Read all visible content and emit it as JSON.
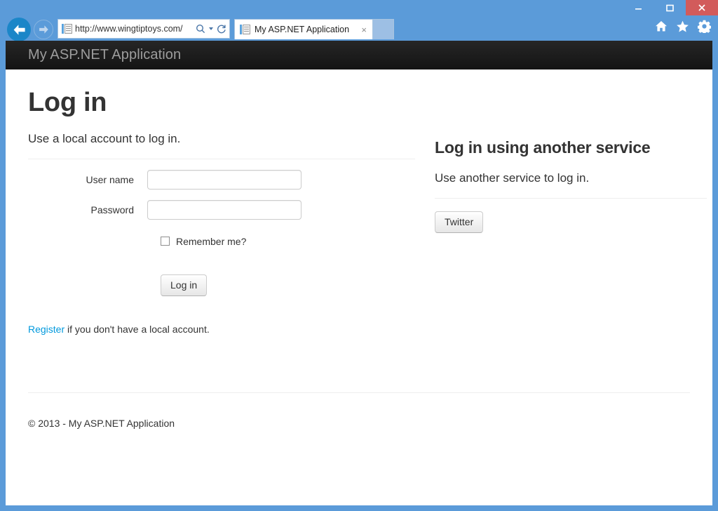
{
  "browser": {
    "window_controls": {
      "minimize_label": "minimize",
      "maximize_label": "maximize",
      "close_label": "×"
    },
    "toolbar_icons": [
      "home-icon",
      "favorites-star-icon",
      "settings-gear-icon"
    ],
    "nav": {
      "back_label": "Back",
      "forward_label": "Forward"
    },
    "address": {
      "url": "http://www.wingtiptoys.com/",
      "placeholder": "http://www.wingtiptoys.com/",
      "search_icon": "search-icon",
      "dropdown_icon": "chevron-down-icon",
      "refresh_icon": "refresh-icon",
      "favicon": "page-document-icon"
    },
    "tab": {
      "title": "My ASP.NET Application",
      "favicon": "page-document-icon",
      "close_label": "×"
    },
    "new_tab_label": ""
  },
  "site": {
    "brand": "My ASP.NET Application"
  },
  "page": {
    "title": "Log in",
    "left": {
      "subtitle": "Use a local account to log in.",
      "fields": [
        {
          "label": "User name",
          "value": "",
          "placeholder": "",
          "type": "text",
          "name": "username"
        },
        {
          "label": "Password",
          "value": "",
          "placeholder": "",
          "type": "password",
          "name": "password"
        }
      ],
      "remember": {
        "label": "Remember me?",
        "checked": false
      },
      "submit_label": "Log in",
      "register": {
        "link_text": "Register",
        "rest_text": " if you don't have a local account."
      }
    },
    "right": {
      "heading": "Log in using another service",
      "subtitle": "Use another service to log in.",
      "services": [
        {
          "label": "Twitter"
        }
      ]
    }
  },
  "footer": {
    "copyright": "© 2013 - My ASP.NET Application"
  },
  "colors": {
    "chrome_blue": "#5b9bd9",
    "close_red": "#d25b5b",
    "navbar_dark": "#141414",
    "link_blue": "#0099dd",
    "text": "#333333"
  }
}
